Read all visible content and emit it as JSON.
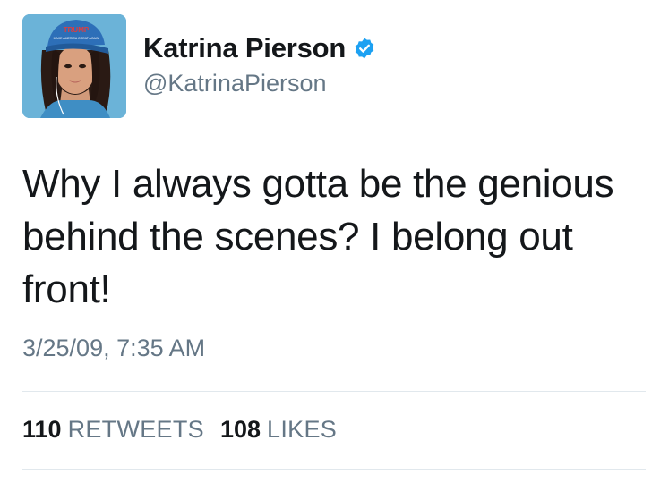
{
  "tweet": {
    "author": {
      "display_name": "Katrina Pierson",
      "handle": "@KatrinaPierson",
      "verified_icon": "verified-badge-icon",
      "avatar_hat_text": "TRUMP",
      "avatar_hat_subtext": "MAKE AMERICA GREAT AGAIN"
    },
    "text": "Why I always gotta be the genious behind the scenes? I belong out front!",
    "timestamp": "3/25/09, 7:35 AM",
    "stats": {
      "retweets_count": "110",
      "retweets_label": "RETWEETS",
      "likes_count": "108",
      "likes_label": "LIKES"
    }
  },
  "colors": {
    "primary_text": "#14171a",
    "secondary_text": "#657786",
    "divider": "#e1e8ed",
    "verified_blue": "#1da1f2"
  }
}
